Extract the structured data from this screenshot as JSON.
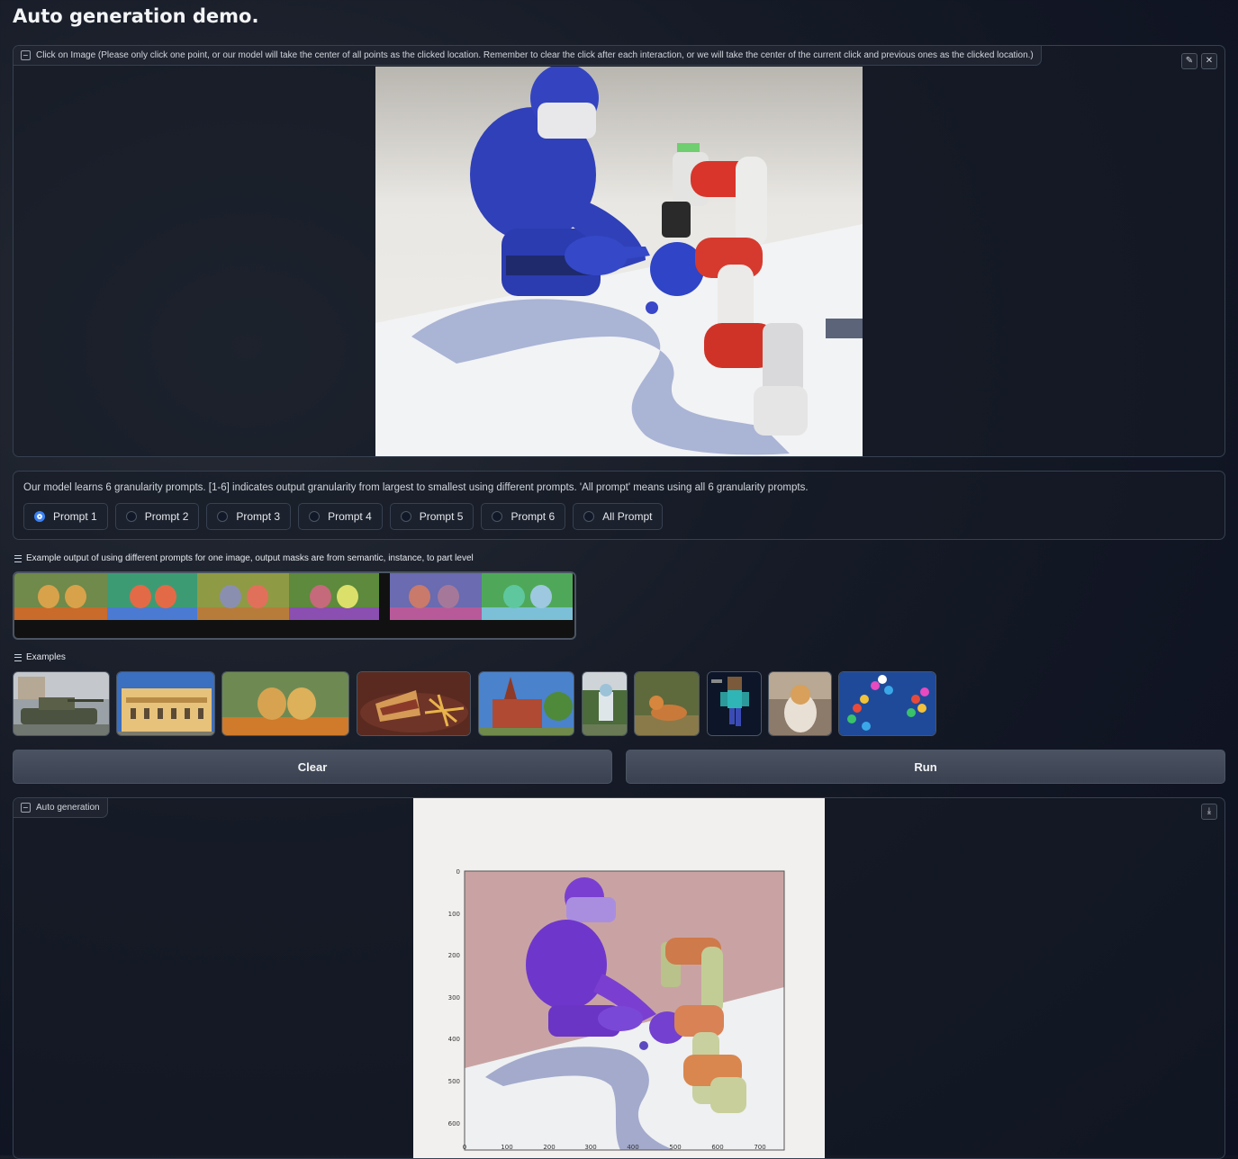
{
  "page_title": "Auto generation demo.",
  "input_image": {
    "label": "Click on Image (Please only click one point, or our model will take the center of all points as the clicked location. Remember to clear the click after each interaction, or we will take the center of the current click and previous ones as the clicked location.)",
    "edit_icon": "pencil-icon",
    "close_icon": "close-icon"
  },
  "granularity": {
    "description": "Our model learns 6 granularity prompts. [1-6] indicates output granularity from largest to smallest using different prompts. 'All prompt' means using all 6 granularity prompts.",
    "options": [
      "Prompt 1",
      "Prompt 2",
      "Prompt 3",
      "Prompt 4",
      "Prompt 5",
      "Prompt 6",
      "All Prompt"
    ],
    "selected": "Prompt 1"
  },
  "example_output": {
    "label": "Example output of using different prompts for one image, output masks are from semantic, instance, to part level"
  },
  "examples": {
    "label": "Examples",
    "items": [
      "tank",
      "colonial building",
      "golden retriever puppies",
      "sandwich with fries",
      "red brick church",
      "sculpture",
      "corgi",
      "minecraft character",
      "cat",
      "balloons"
    ]
  },
  "buttons": {
    "clear": "Clear",
    "run": "Run"
  },
  "output": {
    "label": "Auto generation",
    "download_icon": "download-icon",
    "y_ticks": [
      "0",
      "100",
      "200",
      "300",
      "400",
      "500",
      "600"
    ],
    "x_ticks": [
      "0",
      "100",
      "200",
      "300",
      "400",
      "500",
      "600",
      "700"
    ]
  },
  "colors": {
    "accent": "#3b82f6",
    "robot_blue": "#3346c4",
    "arm_red": "#d9352b"
  }
}
